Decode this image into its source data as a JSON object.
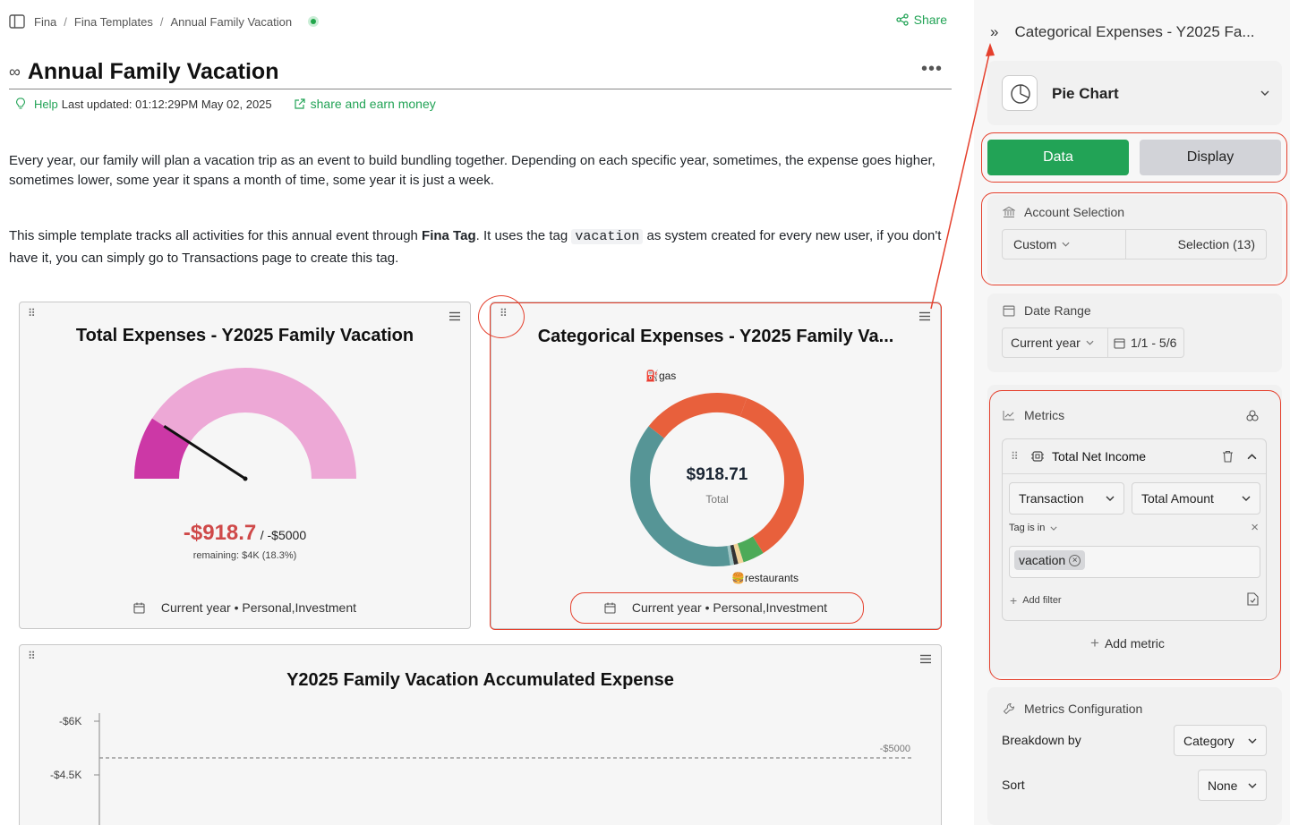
{
  "breadcrumb": [
    "Fina",
    "Fina Templates",
    "Annual Family Vacation"
  ],
  "share_label": "Share",
  "page": {
    "title": "Annual Family Vacation",
    "help": "Help",
    "last_updated": "Last updated: 01:12:29PM May 02, 2025",
    "share_earn": "share and earn money",
    "para1": "Every year, our family will plan a vacation trip as an event to build bundling together. Depending on each specific year, sometimes, the expense goes higher, sometimes lower, some year it spans a month of time, some year it is just a week.",
    "para2_a": "This simple template tracks all activities for this annual event through ",
    "para2_bold": "Fina Tag",
    "para2_b": ".  It uses the tag ",
    "para2_code": "vacation",
    "para2_c": " as system created for every new user, if you don't have it, you can simply go to Transactions page to create this tag."
  },
  "widgets": {
    "total": {
      "title": "Total Expenses - Y2025 Family Vacation",
      "value": "-$918.7",
      "target": "/ -$5000",
      "remaining": "remaining: $4K (18.3%)",
      "footer": "Current year • Personal,Investment",
      "gauge_fraction": 0.183
    },
    "categorical": {
      "title": "Categorical Expenses - Y2025 Family Va...",
      "center_value": "$918.71",
      "center_label": "Total",
      "label_gas": "gas",
      "label_restaurants": "restaurants",
      "footer": "Current year • Personal,Investment"
    },
    "accumulated": {
      "title": "Y2025 Family Vacation Accumulated Expense",
      "target_label": "-$5000",
      "y_ticks": [
        "-$6K",
        "-$4.5K"
      ]
    }
  },
  "chart_data": {
    "type": "pie",
    "title": "Categorical Expenses - Y2025 Family Va...",
    "total": 918.71,
    "slices": [
      {
        "name": "",
        "fraction": 0.355,
        "color": "#e8603c"
      },
      {
        "name": "",
        "fraction": 0.04,
        "color": "#4caa58"
      },
      {
        "name": "",
        "fraction": 0.01,
        "color": "#f2d49a"
      },
      {
        "name": "",
        "fraction": 0.008,
        "color": "#333333"
      },
      {
        "name": "",
        "fraction": 0.007,
        "color": "#9ec5c4"
      },
      {
        "name": "",
        "fraction": 0.38,
        "color": "#569596"
      },
      {
        "name": "",
        "fraction": 0.2,
        "color": "#e8603c"
      }
    ]
  },
  "panel": {
    "title": "Categorical Expenses - Y2025 Fa...",
    "chart_type": "Pie Chart",
    "tab_data": "Data",
    "tab_display": "Display",
    "account_label": "Account Selection",
    "account_mode": "Custom",
    "account_selection": "Selection (13)",
    "date_label": "Date Range",
    "date_mode": "Current year",
    "date_value": "1/1 - 5/6",
    "metrics_label": "Metrics",
    "metric_name": "Total Net Income",
    "metric_source": "Transaction",
    "metric_agg": "Total Amount",
    "filter_label": "Tag is in",
    "filter_tag": "vacation",
    "add_filter": "Add filter",
    "add_metric": "Add metric",
    "config_label": "Metrics Configuration",
    "breakdown_label": "Breakdown by",
    "breakdown_value": "Category",
    "sort_label": "Sort",
    "sort_value": "None"
  },
  "colors": {
    "accent": "#22a356",
    "annotation": "#e5402d",
    "gauge_light": "#eda8d6",
    "gauge_dark": "#cc38a6",
    "negative": "#cf4949"
  }
}
